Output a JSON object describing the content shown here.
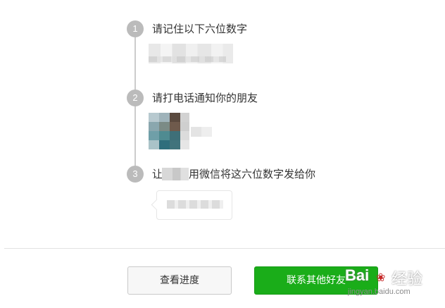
{
  "steps": [
    {
      "number": "1",
      "title": "请记住以下六位数字"
    },
    {
      "number": "2",
      "title": "请打电话通知你的朋友"
    },
    {
      "number": "3",
      "title_prefix": "让",
      "title_suffix": "用微信将这六位数字发给你"
    }
  ],
  "buttons": {
    "progress_label": "查看进度",
    "contact_label": "联系其他好友"
  },
  "watermark": {
    "logo": "Bai",
    "logo_suffix": "经验",
    "url": "jingyan.baidu.com"
  },
  "colors": {
    "accent_green": "#1aad19",
    "step_circle": "#bbbbbb"
  }
}
